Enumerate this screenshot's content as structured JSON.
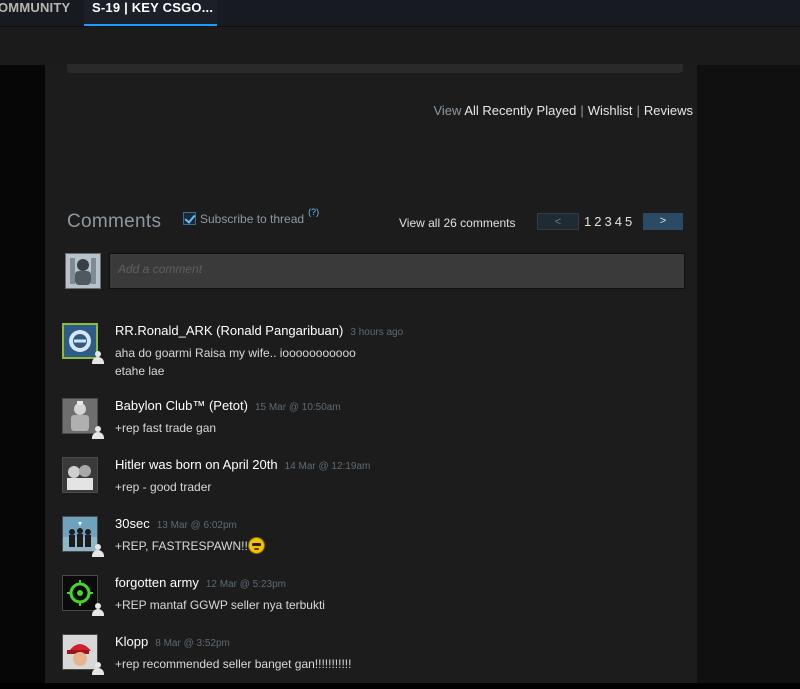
{
  "tabs": [
    {
      "label": "OMMUNITY"
    },
    {
      "label": "S-19 | KEY CSGO..."
    }
  ],
  "profile_links": {
    "prefix": "View",
    "items": [
      "All Recently Played",
      "Wishlist",
      "Reviews"
    ],
    "separator": "|"
  },
  "comments": {
    "title": "Comments",
    "subscribe_label": "Subscribe to thread",
    "help_label": "(?)",
    "view_all": "View all 26 comments",
    "pager": {
      "prev": "<",
      "next": ">",
      "pages": [
        "1",
        "2",
        "3",
        "4",
        "5"
      ]
    },
    "input_placeholder": "Add a comment",
    "list": [
      {
        "author": "RR.Ronald_ARK (Ronald Pangaribuan)",
        "time": "3 hours ago",
        "text": "aha do goarmi Raisa my wife.. iooooooooooo\netahe lae",
        "avatar_icon": "evil-geniuses-logo",
        "online": true
      },
      {
        "author": "Babylon Club™ (Petot)",
        "time": "15 Mar @ 10:50am",
        "text": "+rep fast trade gan",
        "avatar_icon": "statue-photo",
        "online": false
      },
      {
        "author": "Hitler was born on April 20th",
        "time": "14 Mar @ 12:19am",
        "text": "+rep - good trader",
        "avatar_icon": "soldiers-photo",
        "online": false
      },
      {
        "author": "30sec",
        "time": "13 Mar @ 6:02pm",
        "text": "+REP, FASTRESPAWN!!",
        "avatar_icon": "band-photo",
        "online": false,
        "emoji": true
      },
      {
        "author": "forgotten army",
        "time": "12 Mar @ 5:23pm",
        "text": "+REP mantaf GGWP seller nya terbukti",
        "avatar_icon": "razer-logo",
        "online": false
      },
      {
        "author": "Klopp",
        "time": "8 Mar @ 3:52pm",
        "text": "+rep recommended seller banget gan!!!!!!!!!!!",
        "avatar_icon": "red-cap-photo",
        "online": false
      }
    ]
  },
  "colors": {
    "accent": "#66c0f4",
    "page_bg": "#1c1c1c",
    "online_border": "#8fb93b"
  }
}
